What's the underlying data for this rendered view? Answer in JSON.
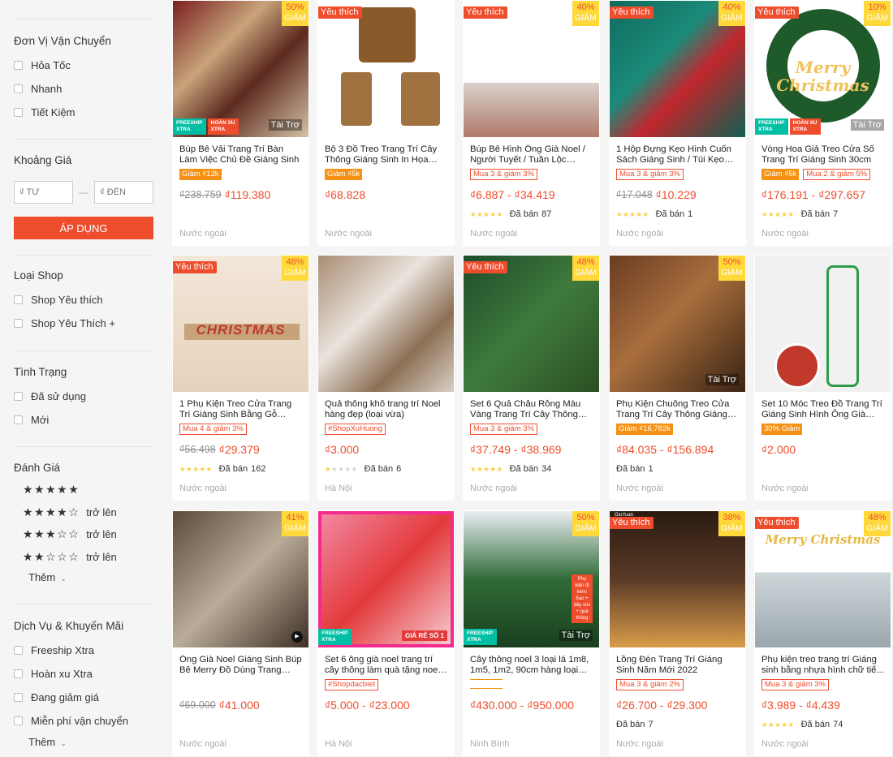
{
  "sidebar": {
    "shipping": {
      "title": "Đơn Vị Vận Chuyển",
      "options": [
        "Hỏa Tốc",
        "Nhanh",
        "Tiết Kiệm"
      ]
    },
    "price": {
      "title": "Khoảng Giá",
      "from_placeholder": "₫ TỪ",
      "to_placeholder": "₫ ĐẾN",
      "separator": "—",
      "apply": "ÁP DỤNG"
    },
    "shop_type": {
      "title": "Loại Shop",
      "options": [
        "Shop Yêu thích",
        "Shop Yêu Thích +"
      ]
    },
    "condition": {
      "title": "Tình Trạng",
      "options": [
        "Đã sử dụng",
        "Mới"
      ]
    },
    "rating": {
      "title": "Đánh Giá",
      "rows": [
        {
          "stars": 5,
          "suffix": ""
        },
        {
          "stars": 4,
          "suffix": "trở lên"
        },
        {
          "stars": 3,
          "suffix": "trở lên"
        },
        {
          "stars": 2,
          "suffix": "trở lên"
        }
      ],
      "more": "Thêm"
    },
    "services": {
      "title": "Dịch Vụ & Khuyến Mãi",
      "options": [
        "Freeship Xtra",
        "Hoàn xu Xtra",
        "Đang giảm giá",
        "Miễn phí vận chuyển"
      ],
      "more": "Thêm"
    }
  },
  "labels": {
    "favorite": "Yêu thích",
    "ads": "Tài Trợ",
    "discount_word": "GIẢM",
    "sold_prefix": "Đã bán"
  },
  "colors": {
    "accent": "#ee4d2d",
    "star": "#ffce3d",
    "discount_badge": "#ffd839",
    "tag_fill": "#f69113"
  },
  "products": [
    {
      "title": "Búp Bê Vải Trang Trí Bàn Làm Việc Chủ Đề Giáng Sinh",
      "discount": "50%",
      "favorite": false,
      "ads": true,
      "freeship": true,
      "tags": [
        {
          "text": "Giảm ₫12k",
          "style": "fill"
        }
      ],
      "old_price": "₫238.759",
      "price": "₫119.380",
      "rating": 0,
      "sold": "",
      "location": "Nước ngoài"
    },
    {
      "title": "Bộ 3 Đồ Treo Trang Trí Cây Thông Giáng Sinh In Họa Tiết...",
      "discount": "",
      "favorite": true,
      "ads": false,
      "freeship": false,
      "tags": [
        {
          "text": "Giảm ₫5k",
          "style": "fill"
        }
      ],
      "old_price": "",
      "price": "₫68.828",
      "rating": 0,
      "sold": "",
      "location": "Nước ngoài"
    },
    {
      "title": "Búp Bê Hình Ông Già Noel / Người Tuyết / Tuần Lộc Tran...",
      "discount": "40%",
      "favorite": true,
      "ads": false,
      "freeship": false,
      "tags": [
        {
          "text": "Mua 3 & giảm 3%",
          "style": "border"
        }
      ],
      "old_price": "",
      "price": "₫6.887 - ₫34.419",
      "rating": 5,
      "sold": "87",
      "location": "Nước ngoài"
    },
    {
      "title": "1 Hộp Đựng Kẹo Hình Cuốn Sách Giáng Sinh / Túi Kẹo M...",
      "discount": "40%",
      "favorite": true,
      "ads": false,
      "freeship": false,
      "tags": [
        {
          "text": "Mua 3 & giảm 3%",
          "style": "border"
        }
      ],
      "old_price": "₫17.048",
      "price": "₫10.229",
      "rating": 5,
      "sold": "1",
      "location": "Nước ngoài"
    },
    {
      "title": "Vòng Hoa Giả Treo Cửa Số Trang Trí Giáng Sinh 30cm",
      "discount": "10%",
      "favorite": true,
      "ads": true,
      "freeship": true,
      "tags": [
        {
          "text": "Giảm ₫5k",
          "style": "fill"
        },
        {
          "text": "Mua 2 & giảm 5%",
          "style": "border"
        }
      ],
      "old_price": "",
      "price": "₫176.191 - ₫297.657",
      "rating": 5,
      "sold": "7",
      "location": "Nước ngoài"
    },
    {
      "title": "1 Phụ Kiện Treo Cửa Trang Trí Giáng Sinh Bằng Gỗ Hình...",
      "discount": "48%",
      "favorite": true,
      "ads": false,
      "freeship": false,
      "tags": [
        {
          "text": "Mua 4 & giảm 3%",
          "style": "border"
        }
      ],
      "old_price": "₫56.498",
      "price": "₫29.379",
      "rating": 5,
      "sold": "162",
      "location": "Nước ngoài"
    },
    {
      "title": "Quả thông khô trang trí Noel hàng đẹp (loại vừa)",
      "discount": "",
      "favorite": false,
      "ads": false,
      "freeship": false,
      "tags": [
        {
          "text": "#ShopXuHuong",
          "style": "border"
        }
      ],
      "old_price": "",
      "price": "₫3.000",
      "rating": 1,
      "sold": "6",
      "location": "Hà Nội"
    },
    {
      "title": "Set 6 Quả Châu Rỗng Màu Vàng Trang Trí Cây Thông Noel",
      "discount": "48%",
      "favorite": true,
      "ads": false,
      "freeship": false,
      "tags": [
        {
          "text": "Mua 3 & giảm 3%",
          "style": "border"
        }
      ],
      "old_price": "",
      "price": "₫37.749 - ₫38.969",
      "rating": 5,
      "sold": "34",
      "location": "Nước ngoài"
    },
    {
      "title": "Phụ Kiện Chuông Treo Cửa Trang Trí Cây Thông Giáng Sinh",
      "discount": "50%",
      "favorite": false,
      "ads": true,
      "freeship": false,
      "tags": [
        {
          "text": "Giảm ₫16,782k",
          "style": "fill"
        }
      ],
      "old_price": "",
      "price": "₫84.035 - ₫156.894",
      "rating": 0,
      "sold": "1",
      "location": "Nước ngoài"
    },
    {
      "title": "Set 10 Móc Treo Đồ Trang Trí Giáng Sinh Hình Ông Già Noel",
      "discount": "",
      "favorite": false,
      "ads": false,
      "freeship": false,
      "tags": [
        {
          "text": "30% Giảm",
          "style": "fill"
        }
      ],
      "old_price": "",
      "price": "₫2.000",
      "rating": 0,
      "sold": "",
      "location": "Nước ngoài"
    },
    {
      "title": "Ông Già Noel Giáng Sinh Búp Bê Merry Đồ Dùng Trang Trí...",
      "discount": "41%",
      "favorite": false,
      "ads": false,
      "freeship": false,
      "tags": [],
      "old_price": "₫69.000",
      "price": "₫41.000",
      "rating": 0,
      "sold": "",
      "location": "Nước ngoài"
    },
    {
      "title": "Set 6 ông già noel trang trí cây thông làm quà tặng noel gián...",
      "discount": "",
      "favorite": false,
      "ads": false,
      "freeship": true,
      "tags": [
        {
          "text": "#Shopdacbiet",
          "style": "border"
        }
      ],
      "old_price": "",
      "price": "₫5.000 - ₫23.000",
      "rating": 0,
      "sold": "",
      "location": "Hà Nội"
    },
    {
      "title": "Cây thông noel 3 loại lá 1m8, 1m5, 1m2, 90cm hàng loại 1...",
      "discount": "50%",
      "favorite": false,
      "ads": true,
      "freeship": true,
      "tags": [],
      "old_price": "",
      "price": "₫430.000 - ₫950.000",
      "rating": 0,
      "sold": "",
      "location": "Ninh Bình"
    },
    {
      "title": "Lồng Đèn Trang Trí Giáng Sinh Năm Mới 2022",
      "discount": "38%",
      "favorite": true,
      "ads": false,
      "freeship": false,
      "tags": [
        {
          "text": "Mua 3 & giảm 2%",
          "style": "border"
        }
      ],
      "old_price": "",
      "price": "₫26.700 - ₫29.300",
      "rating": 0,
      "sold": "7",
      "location": "Nước ngoài"
    },
    {
      "title": "Phụ kiện treo trang trí Giáng sinh bằng nhựa hình chữ tiế...",
      "discount": "48%",
      "favorite": true,
      "ads": false,
      "freeship": false,
      "tags": [
        {
          "text": "Mua 3 & giảm 3%",
          "style": "border"
        }
      ],
      "old_price": "",
      "price": "₫3.989 - ₫4.439",
      "rating": 5,
      "sold": "74",
      "location": "Nước ngoài"
    }
  ],
  "image_texts": {
    "freeship": "FREESHIP",
    "xtra": "XTRA",
    "hoanxu": "HOÀN XU",
    "merry": "MERRY",
    "christmas": "CHRISTMAS",
    "christmas_title": "Christmas",
    "merry_title": "Merry",
    "gia_re": "GIÁ RẺ SỐ 1",
    "phu_kien": "Phụ kiện đi kèm: 5ao + dây xúc + quà thông",
    "giu_yuan": "GiuYuan",
    "merry_christmas": "Merry Christmas"
  }
}
